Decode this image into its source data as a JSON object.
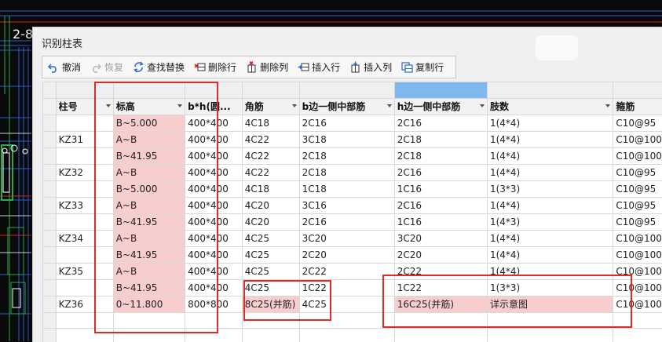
{
  "cad": {
    "label": "2-8"
  },
  "dialog": {
    "title": "识别柱表"
  },
  "toolbar": [
    {
      "name": "undo-button",
      "icon": "undo-icon",
      "label": "撤消",
      "enabled": true
    },
    {
      "name": "redo-button",
      "icon": "redo-icon",
      "label": "恢复",
      "enabled": false
    },
    {
      "name": "find-replace-button",
      "icon": "find-replace-icon",
      "label": "查找替换",
      "enabled": true
    },
    {
      "name": "delete-row-button",
      "icon": "delete-row-icon",
      "label": "删除行",
      "enabled": true
    },
    {
      "name": "delete-column-button",
      "icon": "delete-column-icon",
      "label": "删除列",
      "enabled": true
    },
    {
      "name": "insert-row-button",
      "icon": "insert-row-icon",
      "label": "插入行",
      "enabled": true
    },
    {
      "name": "insert-column-button",
      "icon": "insert-column-icon",
      "label": "插入列",
      "enabled": true
    },
    {
      "name": "copy-row-button",
      "icon": "copy-row-icon",
      "label": "复制行",
      "enabled": true
    }
  ],
  "table": {
    "columns": [
      "柱号",
      "标高",
      "b*h(圆...",
      "角筋",
      "b边一侧中部筋",
      "h边一侧中部筋",
      "肢数",
      "箍筋"
    ],
    "rows": [
      [
        "",
        "B~5.000",
        "400*400",
        "4C18",
        "2C16",
        "2C16",
        "1(4*4)",
        "C10@95"
      ],
      [
        "KZ31",
        "A~B",
        "400*400",
        "4C22",
        "3C18",
        "2C18",
        "1(4*4)",
        "C10@100"
      ],
      [
        "",
        "B~41.95",
        "400*400",
        "4C22",
        "2C18",
        "2C18",
        "1(4*4)",
        "C10@100"
      ],
      [
        "KZ32",
        "A~B",
        "400*400",
        "4C22",
        "2C18",
        "2C16",
        "1(4*4)",
        "C10@95"
      ],
      [
        "",
        "B~5.000",
        "400*400",
        "4C18",
        "1C18",
        "1C16",
        "1(3*3)",
        "C10@95"
      ],
      [
        "KZ33",
        "A~B",
        "400*400",
        "4C20",
        "3C16",
        "2C16",
        "1(4*4)",
        "C10@95"
      ],
      [
        "",
        "B~41.95",
        "400*400",
        "4C20",
        "2C16",
        "1C16",
        "1(4*3)",
        "C10@95"
      ],
      [
        "KZ34",
        "A~B",
        "400*400",
        "4C25",
        "3C20",
        "3C20",
        "1(4*4)",
        "C10@100"
      ],
      [
        "",
        "B~41.95",
        "400*400",
        "4C25",
        "2C20",
        "2C20",
        "1(4*4)",
        "C10@100"
      ],
      [
        "KZ35",
        "A~B",
        "400*400",
        "4C25",
        "2C22",
        "2C22",
        "1(4*4)",
        "C10@100"
      ],
      [
        "",
        "B~41.95",
        "400*400",
        "4C25",
        "1C22",
        "1C22",
        "1(3*3)",
        "C10@100"
      ],
      [
        "KZ36",
        "0~11.800",
        "800*800",
        "8C25(并筋)",
        "4C25",
        "16C25(并筋)",
        "详示意图",
        "C10@100"
      ],
      [
        "",
        "",
        "",
        "",
        "",
        "",
        "",
        ""
      ],
      [
        "",
        "",
        "",
        "",
        "",
        "",
        "",
        ""
      ]
    ]
  },
  "colors": {
    "highlight_pink": "#f8cdcd",
    "selected_column_header": "#7fb7ef",
    "annotation_red": "#e02a2a",
    "cad_background": "#0a0a0a"
  }
}
